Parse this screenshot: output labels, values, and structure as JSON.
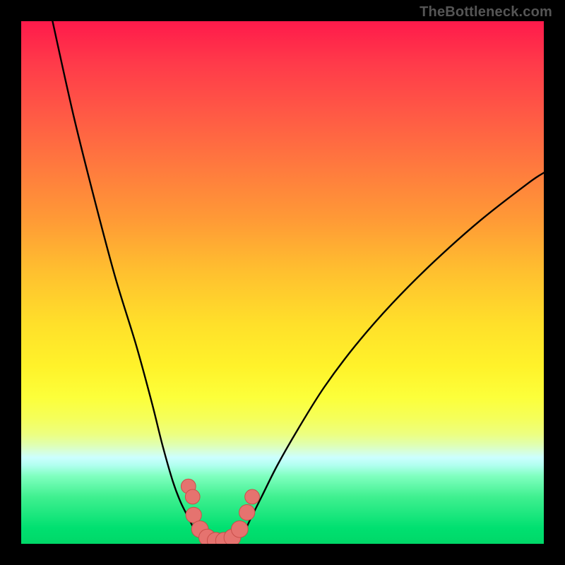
{
  "attribution": "TheBottleneck.com",
  "colors": {
    "frame": "#000000",
    "curve_stroke": "#000000",
    "marker_fill": "#e5736f",
    "marker_stroke": "#c94f4a",
    "gradient_top": "#ff1a4b",
    "gradient_bottom": "#00d868"
  },
  "chart_data": {
    "type": "line",
    "title": "",
    "xlabel": "",
    "ylabel": "",
    "xlim": [
      0,
      100
    ],
    "ylim": [
      0,
      100
    ],
    "grid": false,
    "legend": false,
    "series": [
      {
        "name": "left-branch-curve",
        "x": [
          6,
          10,
          14,
          18,
          22,
          25,
          27,
          29,
          30.5,
          32,
          33,
          34,
          35
        ],
        "y": [
          100,
          82,
          66,
          51,
          38,
          27,
          19,
          12,
          8,
          5,
          3,
          1.5,
          0.5
        ]
      },
      {
        "name": "right-branch-curve",
        "x": [
          41,
          42.5,
          44,
          46,
          49,
          53,
          58,
          64,
          71,
          79,
          88,
          97,
          100
        ],
        "y": [
          0.5,
          2,
          5,
          9,
          15,
          22,
          30,
          38,
          46,
          54,
          62,
          69,
          71
        ]
      },
      {
        "name": "valley-floor",
        "x": [
          35,
          36,
          37,
          38,
          39,
          40,
          41
        ],
        "y": [
          0.5,
          0.2,
          0.1,
          0.1,
          0.1,
          0.2,
          0.5
        ]
      }
    ],
    "markers": [
      {
        "x": 32.0,
        "y": 11.0,
        "r": 1.4
      },
      {
        "x": 32.8,
        "y": 9.0,
        "r": 1.4
      },
      {
        "x": 33.0,
        "y": 5.5,
        "r": 1.5
      },
      {
        "x": 34.2,
        "y": 2.8,
        "r": 1.6
      },
      {
        "x": 35.6,
        "y": 1.2,
        "r": 1.6
      },
      {
        "x": 37.2,
        "y": 0.6,
        "r": 1.6
      },
      {
        "x": 38.8,
        "y": 0.6,
        "r": 1.6
      },
      {
        "x": 40.4,
        "y": 1.2,
        "r": 1.6
      },
      {
        "x": 41.8,
        "y": 2.8,
        "r": 1.6
      },
      {
        "x": 43.2,
        "y": 6.0,
        "r": 1.5
      },
      {
        "x": 44.2,
        "y": 9.0,
        "r": 1.4
      }
    ]
  }
}
